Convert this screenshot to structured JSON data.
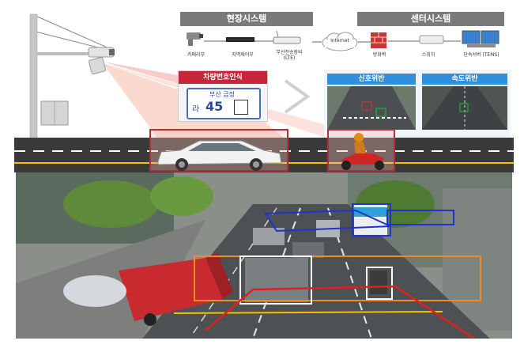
{
  "field_system": {
    "title": "현장시스템",
    "devices": [
      {
        "name": "camera-device",
        "label": "카메라부"
      },
      {
        "name": "controller-device",
        "label": "지역제어부"
      },
      {
        "name": "modem-device",
        "label": "무선전송장비\n(LTE)"
      }
    ],
    "network": "Internet"
  },
  "center_system": {
    "title": "센터시스템",
    "devices": [
      {
        "name": "firewall-device",
        "label": "방화벽"
      },
      {
        "name": "switch-device",
        "label": "스위치"
      },
      {
        "name": "server-device",
        "label": "단속서버 (TEMS)"
      }
    ]
  },
  "plate_recognition": {
    "title": "차량번호인식",
    "plate_region": "부산 금정",
    "plate_prefix": "라",
    "plate_number": "45"
  },
  "violations": {
    "signal": "신호위반",
    "speed": "속도위반"
  },
  "colors": {
    "header_gray": "#7a7a7a",
    "plate_red": "#c8243a",
    "violation_blue": "#2e8fdc",
    "road_dark": "#3a3a3a",
    "lane_yellow": "#f2c200",
    "detect_orange": "#f08a24",
    "detect_blue": "#2233cc",
    "detect_red": "#e02020"
  }
}
